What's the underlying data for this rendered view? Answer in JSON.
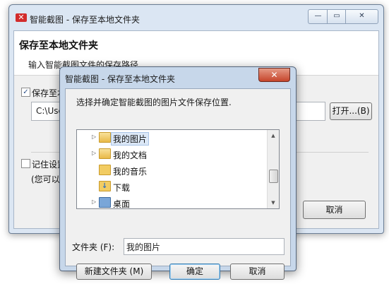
{
  "back_window": {
    "title": "智能截图 - 保存至本地文件夹",
    "logo_glyph": "✕",
    "caption": {
      "minimize": "—",
      "maximize": "▭",
      "close": "✕"
    },
    "heading": "保存至本地文件夹",
    "subheading": "输入智能截图文件的保存路径.",
    "save_checkbox_label": "保存至本",
    "path_value": "C:\\Use",
    "browse_button": "打开...(B)",
    "remember_checkbox_label": "记住设置",
    "hint": "(您可以",
    "cancel_button": "取消"
  },
  "dialog": {
    "title": "智能截图 - 保存至本地文件夹",
    "close_glyph": "✕",
    "instruction": "选择并确定智能截图的图片文件保存位置.",
    "tree_items": [
      {
        "label": "我的图片",
        "arrow": "▷",
        "selected": true
      },
      {
        "label": "我的文档",
        "arrow": "▷",
        "selected": false
      },
      {
        "label": "我的音乐",
        "arrow": "",
        "selected": false
      },
      {
        "label": "下载",
        "arrow": "",
        "selected": false
      },
      {
        "label": "桌面",
        "arrow": "▷",
        "selected": false
      }
    ],
    "folder_label": "文件夹 (F):",
    "folder_value": "我的图片",
    "new_folder_button": "新建文件夹 (M)",
    "ok_button": "确定",
    "cancel_button": "取消"
  },
  "colors": {
    "accent": "#3c7fb1",
    "close_red": "#c6452b",
    "window_frame": "#dbe6f3"
  }
}
